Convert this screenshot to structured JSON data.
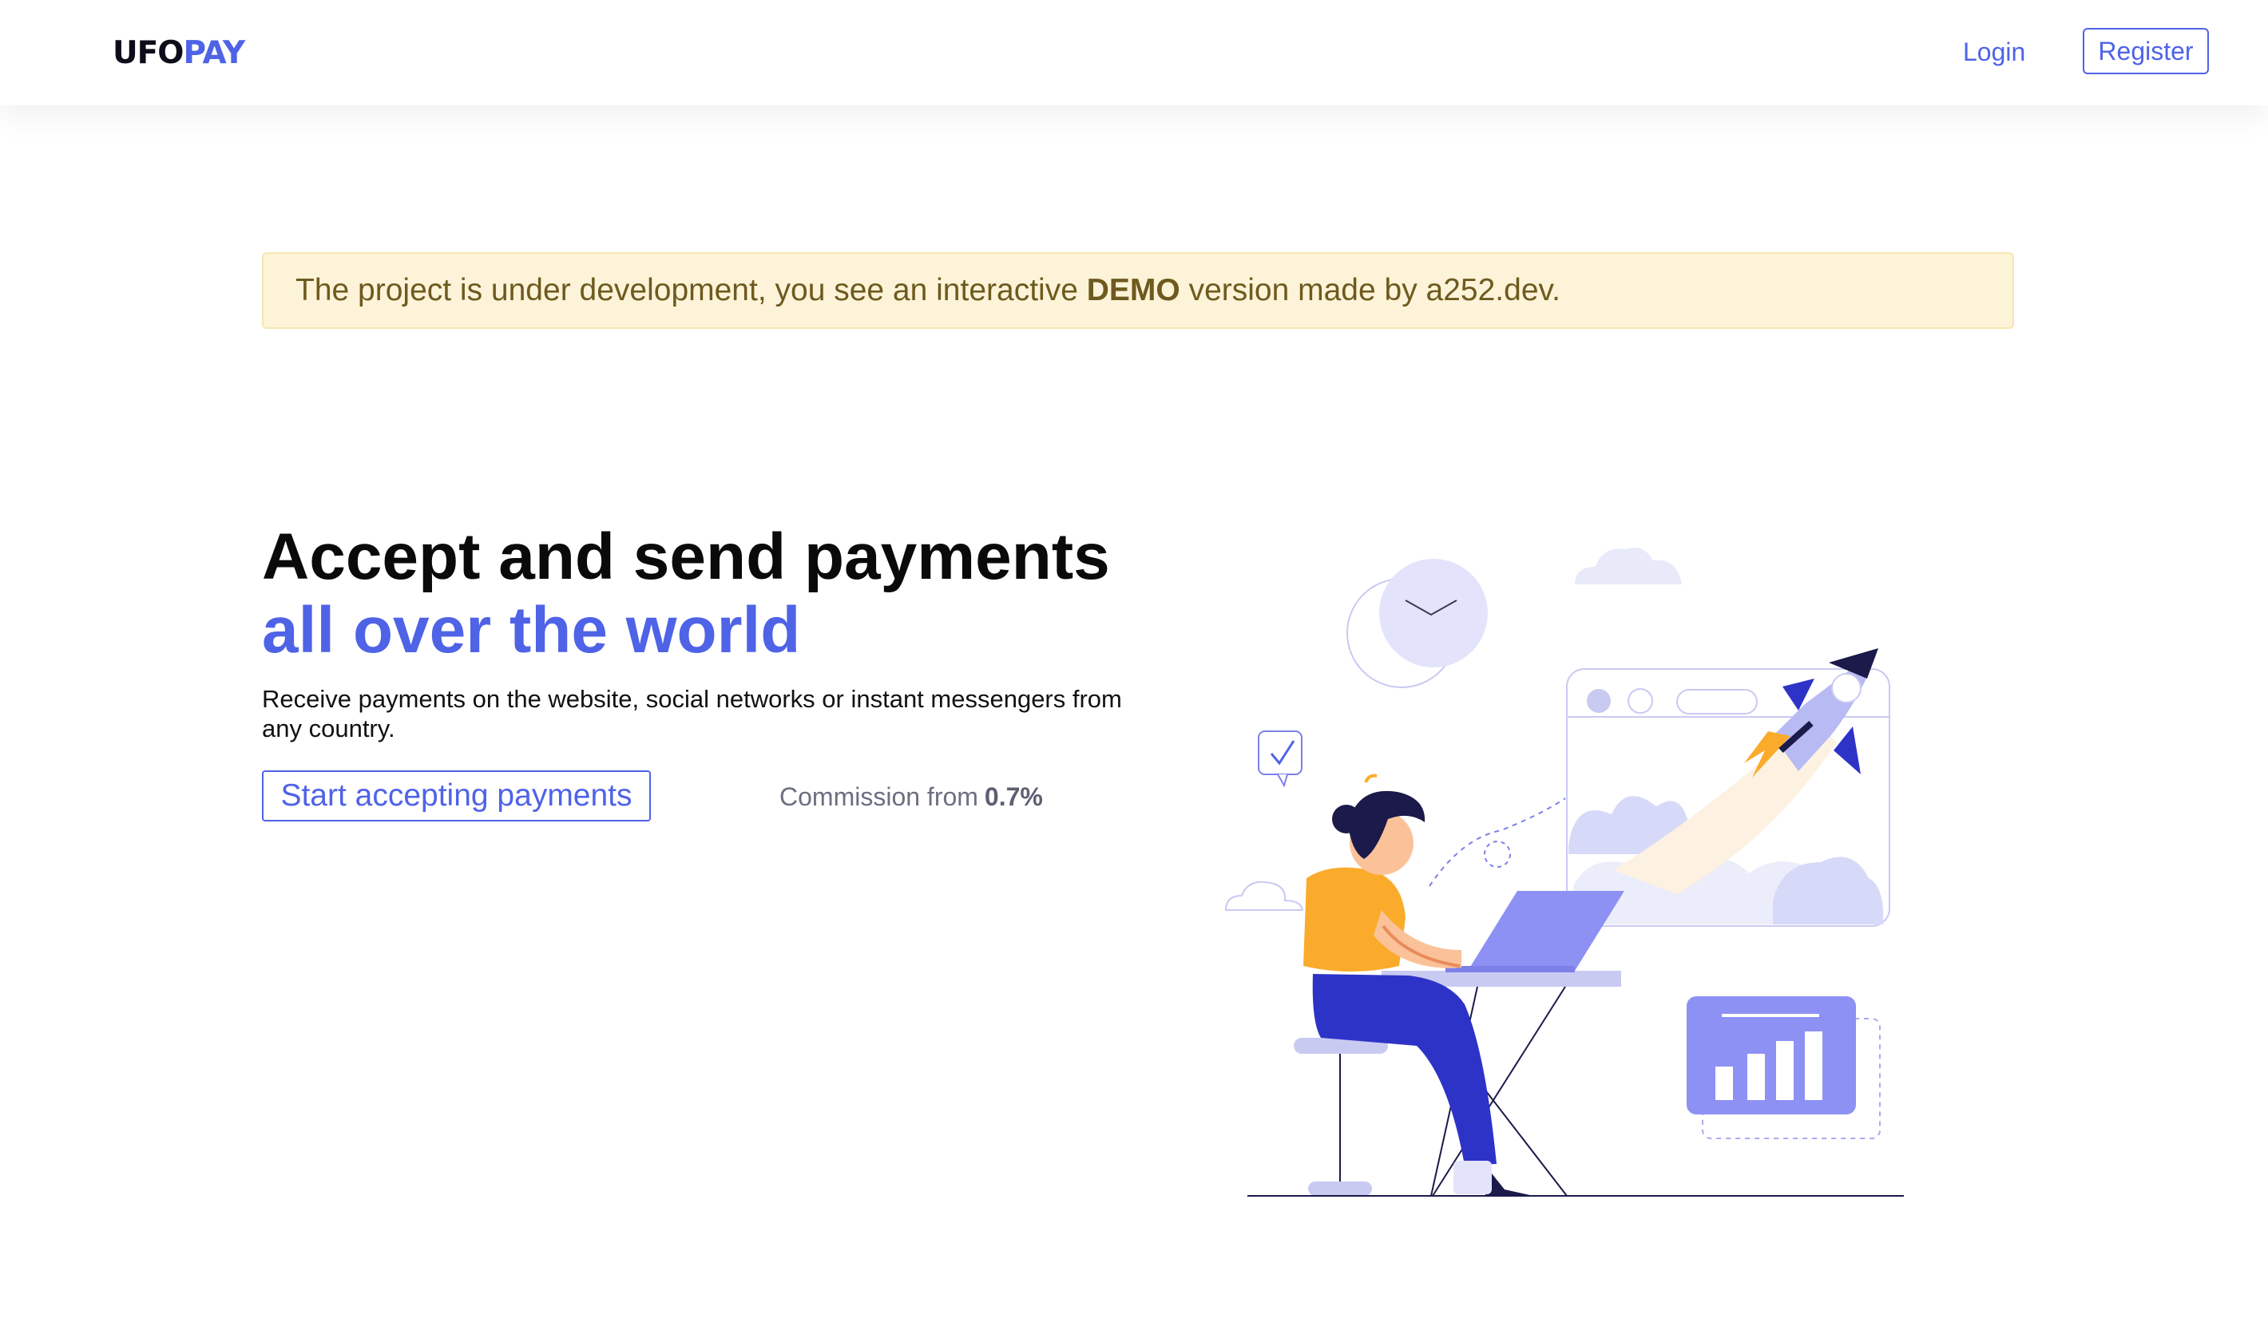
{
  "header": {
    "logo": {
      "part1": "UFO",
      "part2": "PAY"
    },
    "login_label": "Login",
    "register_label": "Register"
  },
  "notice": {
    "text_before": "The project is under development, you see an interactive ",
    "text_bold": "DEMO",
    "text_after": " version made by a252.dev."
  },
  "hero": {
    "title_line1": "Accept and send payments",
    "title_line2": "all over the world",
    "subtitle": "Receive payments on the website, social networks or instant messengers from any country.",
    "cta_label": "Start accepting payments",
    "commission_label": "Commission from",
    "commission_value": "0.7%"
  },
  "colors": {
    "accent": "#4f63e7",
    "notice_bg": "#fcf3d8",
    "notice_text": "#6e5a1e",
    "illustration_orange": "#fbab2c",
    "illustration_indigo": "#2e33c8"
  }
}
